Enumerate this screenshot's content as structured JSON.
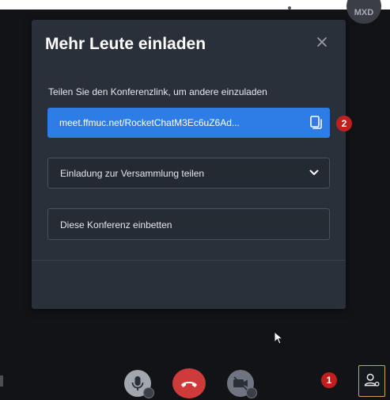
{
  "background": {
    "avatar_initials": "MXD"
  },
  "dialog": {
    "title": "Mehr Leute einladen",
    "share_label": "Teilen Sie den Konferenzlink, um andere einzuladen",
    "link_text": "meet.ffmuc.net/RocketChatM3Ec6uZ6Ad...",
    "invite_select_label": "Einladung zur Versammlung teilen",
    "embed_label": "Diese Konferenz einbetten"
  },
  "badges": {
    "copy_step": "2",
    "participants_step": "1"
  },
  "colors": {
    "accent": "#2e7de6",
    "badge": "#c21e1e",
    "dialog_bg": "#2a3039",
    "hangup": "#cf3b3b"
  }
}
